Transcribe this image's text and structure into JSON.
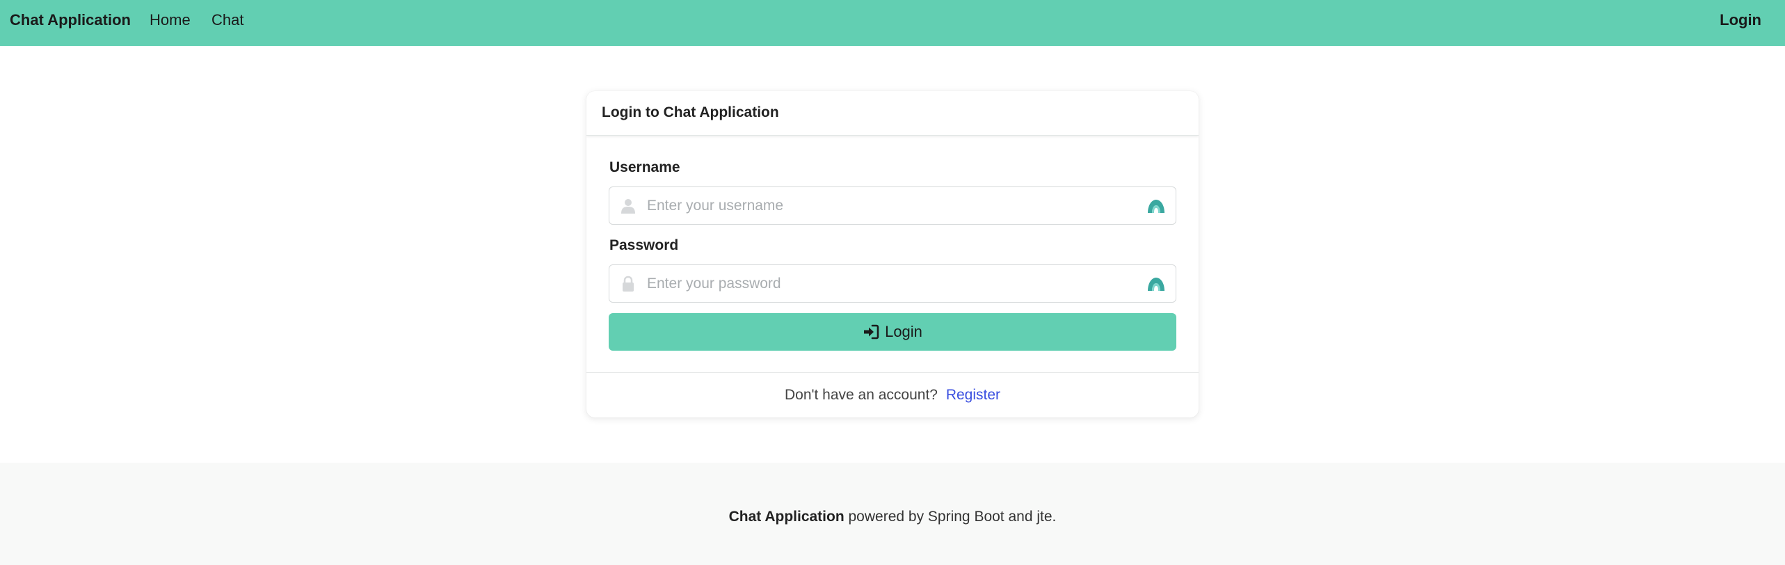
{
  "navbar": {
    "brand": "Chat Application",
    "links": [
      "Home",
      "Chat"
    ],
    "login": "Login"
  },
  "card": {
    "title": "Login to Chat Application",
    "username": {
      "label": "Username",
      "placeholder": "Enter your username",
      "value": ""
    },
    "password": {
      "label": "Password",
      "placeholder": "Enter your password",
      "value": ""
    },
    "submit_label": "Login",
    "footer_text": "Don't have an account?",
    "register_link": "Register"
  },
  "footer": {
    "app_name": "Chat Application",
    "rest": " powered by Spring Boot and jte."
  },
  "icons": {
    "user_field": "user-icon",
    "password_field": "lock-icon",
    "field_extension": "password-manager-icon",
    "submit": "sign-in-icon"
  },
  "colors": {
    "accent": "#62cfb2",
    "link": "#3a4fe0",
    "footer_bg": "#f8f9f8",
    "extension_icon": "#3aa8a0"
  }
}
